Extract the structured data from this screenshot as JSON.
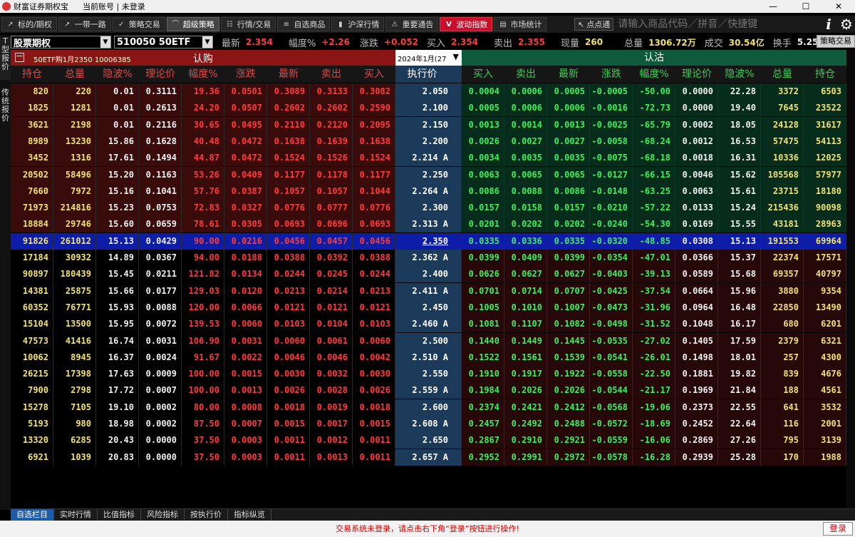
{
  "window": {
    "app_title": "财富证券期权宝",
    "account": "当前账号 | 未登录",
    "min": "—",
    "max": "☐",
    "close": "✕"
  },
  "toolbar": [
    {
      "label": "标的/期权",
      "icon": "trend-icon"
    },
    {
      "label": "一带一路",
      "icon": "trend-icon"
    },
    {
      "label": "策略交易",
      "icon": "check-icon"
    },
    {
      "label": "超级策略",
      "icon": "curve-icon",
      "active": true
    },
    {
      "label": "行情/交易",
      "icon": "chart-icon"
    },
    {
      "label": "自选商品",
      "icon": "list-icon"
    },
    {
      "label": "沪深行情",
      "icon": "bar-chart-icon"
    },
    {
      "label": "重要通告",
      "icon": "warning-icon"
    },
    {
      "label": "波动指数",
      "icon": "v-icon",
      "highlight": true
    },
    {
      "label": "市场统计",
      "icon": "stats-icon"
    }
  ],
  "search": {
    "button": "点点通",
    "placeholder": "请输入商品代码／拼音／快捷键"
  },
  "leftnav": {
    "tab1": "T型报价",
    "tab2": "传统报价"
  },
  "quote": {
    "product": "股票期权",
    "underlying": "510050 50ETF",
    "last_label": "最新",
    "last": "2.354",
    "pct_label": "幅度%",
    "pct": "+2.26",
    "chg_label": "涨跌",
    "chg": "+0.052",
    "bid_label": "买入",
    "bid": "2.354",
    "ask_label": "卖出",
    "ask": "2.355",
    "vol_label": "现量",
    "vol": "260",
    "total_label": "总量",
    "total": "1306.72万",
    "amount_label": "成交",
    "amount": "30.54亿",
    "turnover_label": "换手",
    "turnover": "5.25",
    "policy_button": "策略交易"
  },
  "header": {
    "call_label": "认购",
    "put_label": "认沽",
    "contract": "50ETF购1月2350  10006385",
    "month": "2024年1月(27",
    "call_columns": [
      "持仓",
      "总量",
      "隐波%",
      "理论价",
      "幅度%",
      "涨跌",
      "最新",
      "卖出",
      "买入"
    ],
    "strike_column": "执行价",
    "put_columns": [
      "买入",
      "卖出",
      "最新",
      "涨跌",
      "幅度%",
      "理论价",
      "隐波%",
      "总量",
      "持仓"
    ]
  },
  "colors": {
    "call_red": "#ff3b3b",
    "put_green": "#3cf05a",
    "strike_cyan": "#36e0ef",
    "atm_blue": "#0e1da8",
    "call_bg_itm": "#3a0b0b",
    "put_bg_itm": "#062c1c"
  },
  "atm_row": 9,
  "rows": [
    {
      "call": [
        "820",
        "220",
        "0.01",
        "0.3111",
        "19.36",
        "0.0501",
        "0.3089",
        "0.3133",
        "0.3082"
      ],
      "strike": "2.050",
      "put": [
        "0.0004",
        "0.0006",
        "0.0005",
        "-0.0005",
        "-50.00",
        "0.0000",
        "22.28",
        "3372",
        "6503"
      ]
    },
    {
      "call": [
        "1825",
        "1281",
        "0.01",
        "0.2613",
        "24.20",
        "0.0507",
        "0.2602",
        "0.2602",
        "0.2590"
      ],
      "strike": "2.100",
      "put": [
        "0.0005",
        "0.0006",
        "0.0006",
        "-0.0016",
        "-72.73",
        "0.0000",
        "19.40",
        "7645",
        "23522"
      ]
    },
    {
      "call": [
        "3621",
        "2198",
        "0.01",
        "0.2116",
        "30.65",
        "0.0495",
        "0.2110",
        "0.2120",
        "0.2095"
      ],
      "strike": "2.150",
      "put": [
        "0.0013",
        "0.0014",
        "0.0013",
        "-0.0025",
        "-65.79",
        "0.0002",
        "18.05",
        "24128",
        "31617"
      ]
    },
    {
      "call": [
        "8989",
        "13230",
        "15.86",
        "0.1628",
        "40.48",
        "0.0472",
        "0.1638",
        "0.1639",
        "0.1638"
      ],
      "strike": "2.200",
      "put": [
        "0.0026",
        "0.0027",
        "0.0027",
        "-0.0058",
        "-68.24",
        "0.0012",
        "16.53",
        "57475",
        "54113"
      ]
    },
    {
      "call": [
        "3452",
        "1316",
        "17.61",
        "0.1494",
        "44.87",
        "0.0472",
        "0.1524",
        "0.1526",
        "0.1524"
      ],
      "strike": "2.214 A",
      "put": [
        "0.0034",
        "0.0035",
        "0.0035",
        "-0.0075",
        "-68.18",
        "0.0018",
        "16.31",
        "10336",
        "12025"
      ]
    },
    {
      "call": [
        "20502",
        "58496",
        "15.20",
        "0.1163",
        "53.26",
        "0.0409",
        "0.1177",
        "0.1178",
        "0.1177"
      ],
      "strike": "2.250",
      "put": [
        "0.0063",
        "0.0065",
        "0.0065",
        "-0.0127",
        "-66.15",
        "0.0046",
        "15.62",
        "105568",
        "57977"
      ]
    },
    {
      "call": [
        "7660",
        "7972",
        "15.16",
        "0.1041",
        "57.76",
        "0.0387",
        "0.1057",
        "0.1057",
        "0.1044"
      ],
      "strike": "2.264 A",
      "put": [
        "0.0086",
        "0.0088",
        "0.0086",
        "-0.0148",
        "-63.25",
        "0.0063",
        "15.61",
        "23715",
        "18180"
      ]
    },
    {
      "call": [
        "71973",
        "214816",
        "15.23",
        "0.0753",
        "72.83",
        "0.0327",
        "0.0776",
        "0.0777",
        "0.0776"
      ],
      "strike": "2.300",
      "put": [
        "0.0157",
        "0.0158",
        "0.0157",
        "-0.0210",
        "-57.22",
        "0.0133",
        "15.24",
        "215436",
        "90098"
      ]
    },
    {
      "call": [
        "18884",
        "29746",
        "15.60",
        "0.0659",
        "78.61",
        "0.0305",
        "0.0693",
        "0.0696",
        "0.0693"
      ],
      "strike": "2.313 A",
      "put": [
        "0.0201",
        "0.0202",
        "0.0202",
        "-0.0240",
        "-54.30",
        "0.0169",
        "15.55",
        "43181",
        "28963"
      ]
    },
    {
      "call": [
        "91826",
        "261012",
        "15.13",
        "0.0429",
        "90.00",
        "0.0216",
        "0.0456",
        "0.0457",
        "0.0456"
      ],
      "strike": "2.350",
      "put": [
        "0.0335",
        "0.0336",
        "0.0335",
        "-0.0320",
        "-48.85",
        "0.0308",
        "15.13",
        "191553",
        "69964"
      ]
    },
    {
      "call": [
        "17184",
        "30932",
        "14.89",
        "0.0367",
        "94.00",
        "0.0188",
        "0.0388",
        "0.0392",
        "0.0388"
      ],
      "strike": "2.362 A",
      "put": [
        "0.0399",
        "0.0409",
        "0.0399",
        "-0.0354",
        "-47.01",
        "0.0366",
        "15.37",
        "22374",
        "17571"
      ]
    },
    {
      "call": [
        "90897",
        "180439",
        "15.45",
        "0.0211",
        "121.82",
        "0.0134",
        "0.0244",
        "0.0245",
        "0.0244"
      ],
      "strike": "2.400",
      "put": [
        "0.0626",
        "0.0627",
        "0.0627",
        "-0.0403",
        "-39.13",
        "0.0589",
        "15.68",
        "69357",
        "40797"
      ]
    },
    {
      "call": [
        "14381",
        "25875",
        "15.66",
        "0.0177",
        "129.03",
        "0.0120",
        "0.0213",
        "0.0214",
        "0.0213"
      ],
      "strike": "2.411 A",
      "put": [
        "0.0701",
        "0.0714",
        "0.0707",
        "-0.0425",
        "-37.54",
        "0.0664",
        "15.96",
        "3880",
        "9354"
      ]
    },
    {
      "call": [
        "60352",
        "76771",
        "15.93",
        "0.0088",
        "120.00",
        "0.0066",
        "0.0121",
        "0.0121",
        "0.0121"
      ],
      "strike": "2.450",
      "put": [
        "0.1005",
        "0.1010",
        "0.1007",
        "-0.0473",
        "-31.96",
        "0.0964",
        "16.48",
        "22850",
        "13490"
      ]
    },
    {
      "call": [
        "15104",
        "13500",
        "15.95",
        "0.0072",
        "139.53",
        "0.0060",
        "0.0103",
        "0.0104",
        "0.0103"
      ],
      "strike": "2.460 A",
      "put": [
        "0.1081",
        "0.1107",
        "0.1082",
        "-0.0498",
        "-31.52",
        "0.1048",
        "16.17",
        "680",
        "6201"
      ]
    },
    {
      "call": [
        "47573",
        "41416",
        "16.74",
        "0.0031",
        "106.90",
        "0.0031",
        "0.0060",
        "0.0061",
        "0.0060"
      ],
      "strike": "2.500",
      "put": [
        "0.1440",
        "0.1449",
        "0.1445",
        "-0.0535",
        "-27.02",
        "0.1405",
        "17.59",
        "2379",
        "6321"
      ]
    },
    {
      "call": [
        "10062",
        "8945",
        "16.37",
        "0.0024",
        "91.67",
        "0.0022",
        "0.0046",
        "0.0046",
        "0.0042"
      ],
      "strike": "2.510 A",
      "put": [
        "0.1522",
        "0.1561",
        "0.1539",
        "-0.0541",
        "-26.01",
        "0.1498",
        "18.01",
        "257",
        "4300"
      ]
    },
    {
      "call": [
        "26215",
        "17398",
        "17.63",
        "0.0009",
        "100.00",
        "0.0015",
        "0.0030",
        "0.0032",
        "0.0030"
      ],
      "strike": "2.550",
      "put": [
        "0.1910",
        "0.1917",
        "0.1922",
        "-0.0558",
        "-22.50",
        "0.1881",
        "19.82",
        "839",
        "4676"
      ]
    },
    {
      "call": [
        "7900",
        "2798",
        "17.72",
        "0.0007",
        "100.00",
        "0.0013",
        "0.0026",
        "0.0028",
        "0.0026"
      ],
      "strike": "2.559 A",
      "put": [
        "0.1984",
        "0.2026",
        "0.2026",
        "-0.0544",
        "-21.17",
        "0.1969",
        "21.84",
        "188",
        "4561"
      ]
    },
    {
      "call": [
        "15278",
        "7105",
        "19.10",
        "0.0002",
        "80.00",
        "0.0008",
        "0.0018",
        "0.0019",
        "0.0018"
      ],
      "strike": "2.600",
      "put": [
        "0.2374",
        "0.2421",
        "0.2412",
        "-0.0568",
        "-19.06",
        "0.2373",
        "22.55",
        "641",
        "3532"
      ]
    },
    {
      "call": [
        "5193",
        "980",
        "18.98",
        "0.0002",
        "87.50",
        "0.0007",
        "0.0015",
        "0.0017",
        "0.0015"
      ],
      "strike": "2.608 A",
      "put": [
        "0.2457",
        "0.2492",
        "0.2488",
        "-0.0572",
        "-18.69",
        "0.2452",
        "22.64",
        "116",
        "2001"
      ]
    },
    {
      "call": [
        "13320",
        "6285",
        "20.43",
        "0.0000",
        "37.50",
        "0.0003",
        "0.0011",
        "0.0012",
        "0.0011"
      ],
      "strike": "2.650",
      "put": [
        "0.2867",
        "0.2910",
        "0.2921",
        "-0.0559",
        "-16.06",
        "0.2869",
        "27.26",
        "795",
        "3139"
      ]
    },
    {
      "call": [
        "6921",
        "1039",
        "20.83",
        "0.0000",
        "37.50",
        "0.0003",
        "0.0011",
        "0.0013",
        "0.0011"
      ],
      "strike": "2.657 A",
      "put": [
        "0.2952",
        "0.2991",
        "0.2972",
        "-0.0578",
        "-16.28",
        "0.2939",
        "25.28",
        "170",
        "1988"
      ]
    }
  ],
  "bottom_tabs": [
    "自选栏目",
    "实时行情",
    "比值指标",
    "风险指标",
    "按执行价",
    "指标纵览"
  ],
  "status": {
    "message": "交易系统未登录，请点击右下角“登录”按钮进行操作!",
    "login": "登录"
  }
}
